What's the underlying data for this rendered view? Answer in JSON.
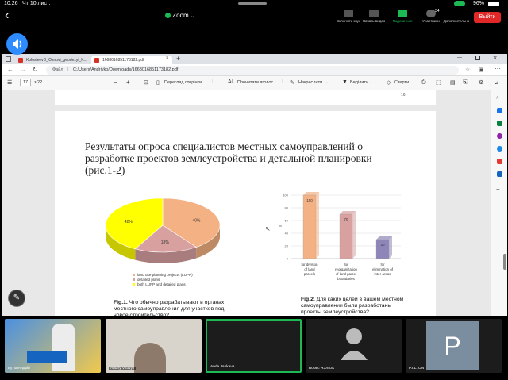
{
  "status": {
    "time": "10:26",
    "date": "Чт 10 лист.",
    "battery": "96%"
  },
  "zoom": {
    "title": "Zoom",
    "mute_label": "Включить звук",
    "video_label": "Начать видео",
    "share_label": "Поделиться",
    "participants_label": "Участники",
    "participants_count": "34",
    "more_label": "Дополнительно",
    "leave_label": "Выйти"
  },
  "browser": {
    "tabs": [
      {
        "label": "KolosleevD_Osnovi_geodezyi_K..."
      },
      {
        "label": "1668016851173182.pdf"
      }
    ],
    "address": {
      "file_label": "Файл",
      "path": "C:/Users/Andriyko/Downloads/1668016851173182.pdf"
    },
    "pdf": {
      "page_current": "17",
      "page_total": "з 22",
      "fit_label": "Перегляд сторінки",
      "read_label": "Прочитати вголос",
      "draw_label": "Накреслити",
      "highlight_label": "Виділити",
      "erase_label": "Стерти",
      "prev_page_num": "16"
    }
  },
  "slide": {
    "title": "Результаты опроса специалистов местных самоуправлений о разработке проектов землеустройства и детальной планировки (рис.1-2)",
    "fig1_caption_bold": "Fig.1.",
    "fig1_caption": " Что обычно разрабатывают в органах местного самоуправления для участков под новое строительство?",
    "fig2_caption_bold": "Fig.2.",
    "fig2_caption": " Для каких целей в вашем местном самоуправлении были разработаны проекты землеустройства?"
  },
  "chart_data": [
    {
      "type": "pie",
      "categories": [
        "land use planning projects (LUPP)",
        "detailed plans",
        "both LUPP and detailed plans"
      ],
      "values": [
        40,
        18,
        42
      ],
      "data_labels": [
        "40%",
        "18%",
        "42%"
      ],
      "colors": [
        "#f4b183",
        "#d9a0a0",
        "#ffff00"
      ],
      "legend": "bottom"
    },
    {
      "type": "bar",
      "categories": [
        "for division of land parcels",
        "for reorganization of land parcel boundaries",
        "for elimination of inter-areas"
      ],
      "values": [
        100,
        70,
        30
      ],
      "colors": [
        "#f4b183",
        "#d9a0a0",
        "#8e86b8"
      ],
      "ylabel": "%",
      "ylim": [
        0,
        100
      ],
      "yticks": [
        "0",
        "20",
        "40",
        "60",
        "80",
        "100"
      ],
      "grid": true
    }
  ],
  "participants": [
    {
      "name": "БутовАндрій"
    },
    {
      "name": "Andriy Vitovyy"
    },
    {
      "name": "Anda Jankava"
    },
    {
      "name": "Борис ЯЗЛЮК"
    },
    {
      "name": "P.I.L. ON",
      "initial": "P"
    }
  ],
  "colors": {
    "share_green": "#1db954",
    "leave_red": "#e02828",
    "zoom_blue": "#2d8cff"
  }
}
